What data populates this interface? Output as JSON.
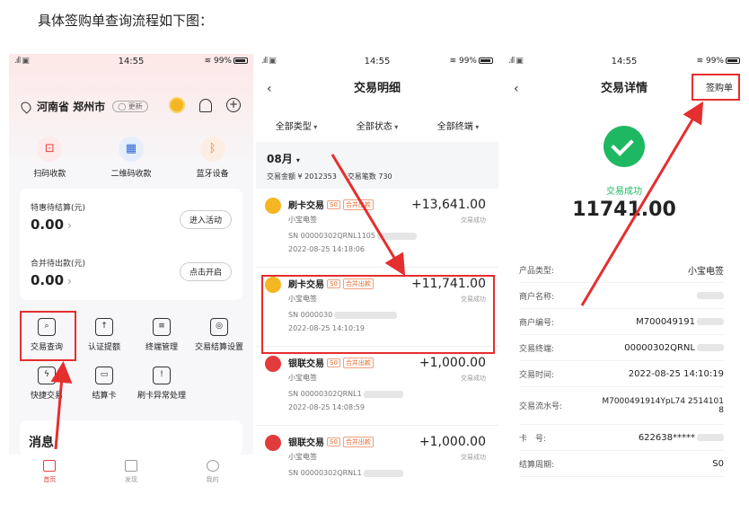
{
  "caption": "具体签购单查询流程如下图：",
  "status": {
    "time": "14:55",
    "battery": "99%"
  },
  "p1": {
    "location": "河南省 郑州市",
    "update": "更新",
    "quick": [
      "扫码收款",
      "二维码收款",
      "蓝牙设备"
    ],
    "bal1": {
      "label": "特惠待结算(元)",
      "value": "0.00",
      "button": "进入活动"
    },
    "bal2": {
      "label": "合并待出款(元)",
      "value": "0.00",
      "button": "点击开启"
    },
    "grid_row1": [
      "交易查询",
      "认证提额",
      "终端管理",
      "交易结算设置"
    ],
    "grid_row2": [
      "快捷交易",
      "结算卡",
      "刷卡异常处理"
    ],
    "message": "消息",
    "tabs": [
      "首页",
      "发现",
      "我的"
    ]
  },
  "p2": {
    "title": "交易明细",
    "filters": [
      "全部类型",
      "全部状态",
      "全部终端"
    ],
    "month": "08月",
    "sum_amount": "交易金额 ¥ 2012353",
    "sum_count": "交易笔数 730",
    "tags": {
      "s0": "S0",
      "merge": "合并出款"
    },
    "txs": [
      {
        "name": "刷卡交易",
        "amount": "+13,641.00",
        "status": "交易成功",
        "shop": "小宝电签",
        "sn": "SN 00000302QRNL1105",
        "date": "2022-08-25 14:18:06"
      },
      {
        "name": "刷卡交易",
        "amount": "+11,741.00",
        "status": "交易成功",
        "shop": "小宝电签",
        "sn": "SN 0000030",
        "date": "2022-08-25 14:10:19"
      },
      {
        "name": "银联交易",
        "amount": "+1,000.00",
        "status": "交易成功",
        "shop": "小宝电签",
        "sn": "SN 00000302QRNL1",
        "date": "2022-08-25 14:08:59"
      },
      {
        "name": "银联交易",
        "amount": "+1,000.00",
        "status": "交易成功",
        "shop": "小宝电签",
        "sn": "SN 00000302QRNL1",
        "date": ""
      }
    ]
  },
  "p3": {
    "title": "交易详情",
    "action": "签购单",
    "success": "交易成功",
    "amount": "11741.00",
    "rows": [
      {
        "k": "产品类型:",
        "v": "小宝电签"
      },
      {
        "k": "商户名称:",
        "v": ""
      },
      {
        "k": "商户编号:",
        "v": "M700049191"
      },
      {
        "k": "交易终端:",
        "v": "00000302QRNL"
      },
      {
        "k": "交易时间:",
        "v": "2022-08-25 14:10:19"
      },
      {
        "k": "交易流水号:",
        "v": "M7000491914YpL74 25141018"
      },
      {
        "k": "卡　号:",
        "v": "622638*****"
      },
      {
        "k": "结算周期:",
        "v": "S0"
      }
    ]
  }
}
